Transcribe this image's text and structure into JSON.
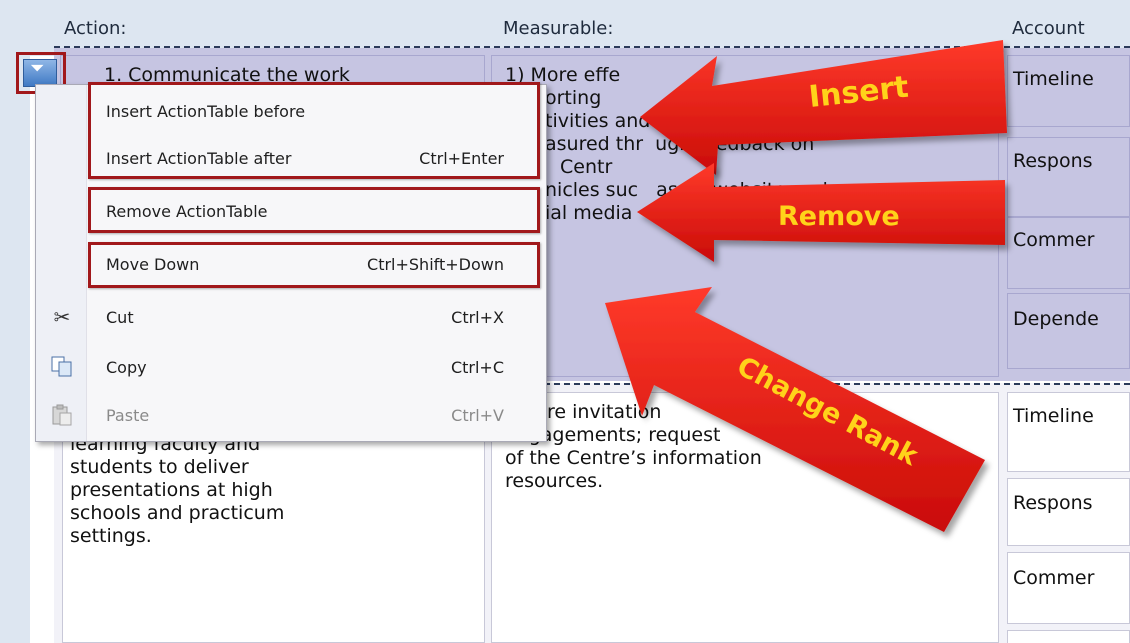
{
  "table": {
    "headers": {
      "action": "Action:",
      "measurable": "Measurable:",
      "accountability": "Account"
    },
    "row1": {
      "action_text": "1. Communicate the work",
      "measurable_lines": [
        "1) More effe",
        "orting",
        "tivities and  itiatives as",
        "asured thr  ugh feedback on",
        "Centr",
        "nicles suc   as its website and",
        "ial media"
      ],
      "accountability_labels": [
        "Timeline",
        "Respons",
        "Commer",
        "Depende"
      ]
    },
    "row2": {
      "action_lines": [
        "learning faculty and",
        "students to deliver",
        "presentations at high",
        "schools and practicum",
        "settings."
      ],
      "measurable_lines": [
        "More invitation",
        "engagements; request",
        "of the Centre’s information",
        "resources."
      ],
      "accountability_labels": [
        "Timeline",
        "Respons",
        "Commer"
      ]
    }
  },
  "context_menu": {
    "items": [
      {
        "label": "Insert ActionTable before",
        "shortcut": ""
      },
      {
        "label": "Insert ActionTable after",
        "shortcut": "Ctrl+Enter"
      },
      {
        "label": "Remove ActionTable",
        "shortcut": ""
      },
      {
        "label": "Move Down",
        "shortcut": "Ctrl+Shift+Down"
      },
      {
        "label": "Cut",
        "shortcut": "Ctrl+X",
        "icon": "scissors-icon"
      },
      {
        "label": "Copy",
        "shortcut": "Ctrl+C",
        "icon": "copy-icon"
      },
      {
        "label": "Paste",
        "shortcut": "Ctrl+V",
        "icon": "paste-icon",
        "disabled": true
      }
    ]
  },
  "callouts": {
    "insert": "Insert",
    "remove": "Remove",
    "change_rank": "Change Rank"
  },
  "colors": {
    "callout_arrow": "#e8120c",
    "callout_text": "#ffd31a",
    "highlight_box": "#a1181b",
    "row_selected": "#c6c5e2"
  }
}
